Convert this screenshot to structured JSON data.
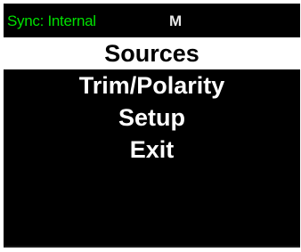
{
  "status": {
    "sync_label": "Sync: Internal",
    "mode_indicator": "M"
  },
  "menu": {
    "items": [
      {
        "label": "Sources",
        "selected": true
      },
      {
        "label": "Trim/Polarity",
        "selected": false
      },
      {
        "label": "Setup",
        "selected": false
      },
      {
        "label": "Exit",
        "selected": false
      }
    ]
  },
  "colors": {
    "screen_background": "#000000",
    "status_text": "#00e000",
    "menu_text": "#ffffff",
    "selection_background": "#ffffff",
    "selection_text": "#000000"
  }
}
